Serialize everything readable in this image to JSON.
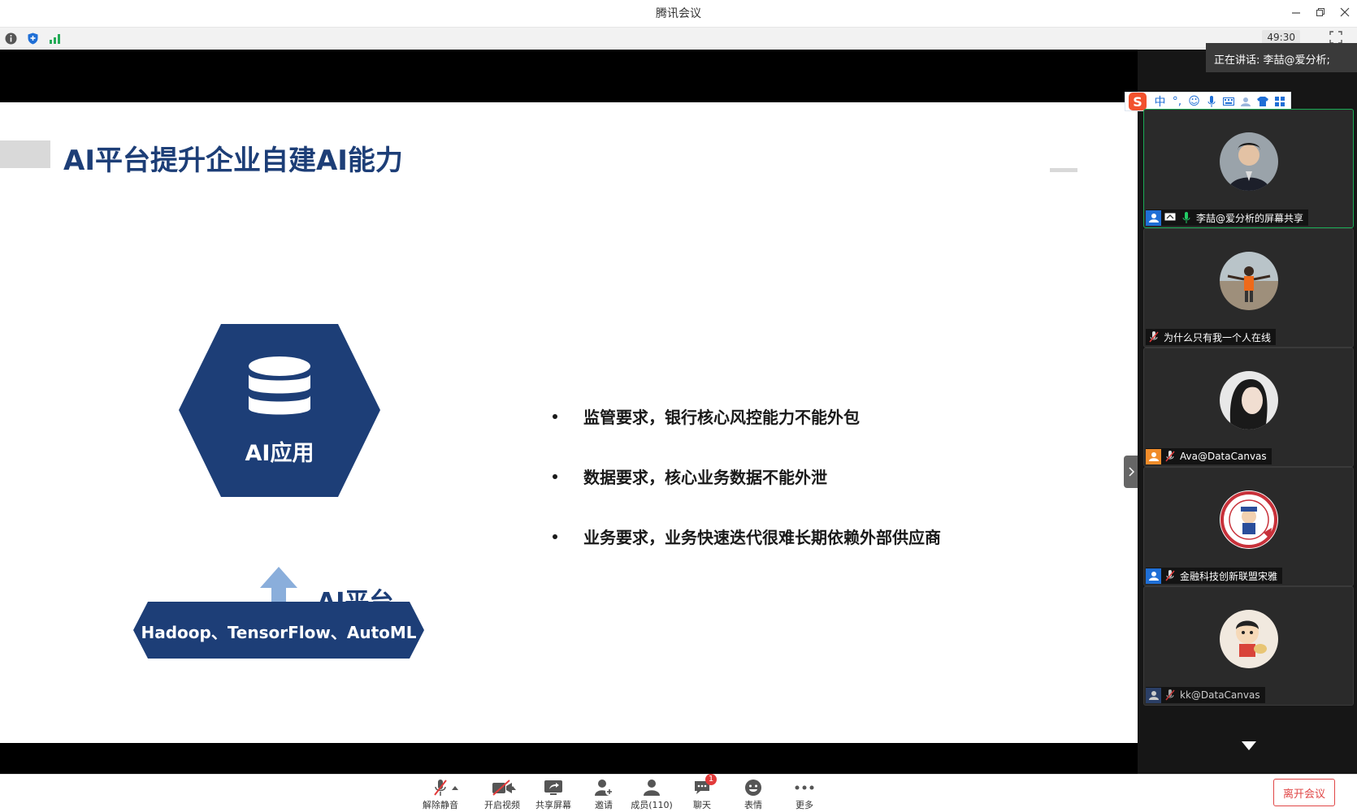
{
  "window": {
    "title": "腾讯会议",
    "minimize_icon": "minimize-icon",
    "restore_icon": "restore-icon",
    "close_icon": "close-icon"
  },
  "statusbar": {
    "timer": "49:30",
    "icons": [
      "info-icon",
      "shield-icon",
      "signal-icon",
      "fullscreen-icon"
    ]
  },
  "slide": {
    "title": "AI平台提升企业自建AI能力",
    "hexagon_label": "AI应用",
    "platform_label": "AI平台",
    "tech_label": "Hadoop、TensorFlow、AutoML",
    "bullets": [
      "监管要求，银行核心风控能力不能外包",
      "数据要求，核心业务数据不能外泄",
      "业务要求，业务快速迭代很难长期依赖外部供应商"
    ],
    "colors": {
      "primary": "#1d3e77",
      "arrow": "#8aaedb"
    }
  },
  "speaking": {
    "text": "正在讲话: 李喆@爱分析;"
  },
  "ime": {
    "logo": "S",
    "items": [
      "中",
      "°,",
      "☺",
      "mic",
      "kbd",
      "user",
      "shirt",
      "grid"
    ]
  },
  "participants": [
    {
      "name": "李喆@爱分析的屏幕共享",
      "active": true,
      "icons": [
        "user-icon",
        "screen-share-icon",
        "mic-on-icon"
      ]
    },
    {
      "name": "为什么只有我一个人在线",
      "active": false,
      "icons": [
        "mic-muted-icon"
      ]
    },
    {
      "name": "Ava@DataCanvas",
      "active": false,
      "icons": [
        "user-icon",
        "mic-muted-icon"
      ]
    },
    {
      "name": "金融科技创新联盟宋雅",
      "active": false,
      "icons": [
        "user-icon",
        "mic-muted-icon"
      ]
    },
    {
      "name": "kk@DataCanvas",
      "active": false,
      "icons": [
        "user-icon",
        "mic-muted-icon"
      ]
    }
  ],
  "toolbar": {
    "unmute": "解除静音",
    "start_video": "开启视频",
    "share_screen": "共享屏幕",
    "invite": "邀请",
    "members": "成员(110)",
    "chat": "聊天",
    "chat_badge": "1",
    "reactions": "表情",
    "more": "更多",
    "leave": "离开会议"
  }
}
